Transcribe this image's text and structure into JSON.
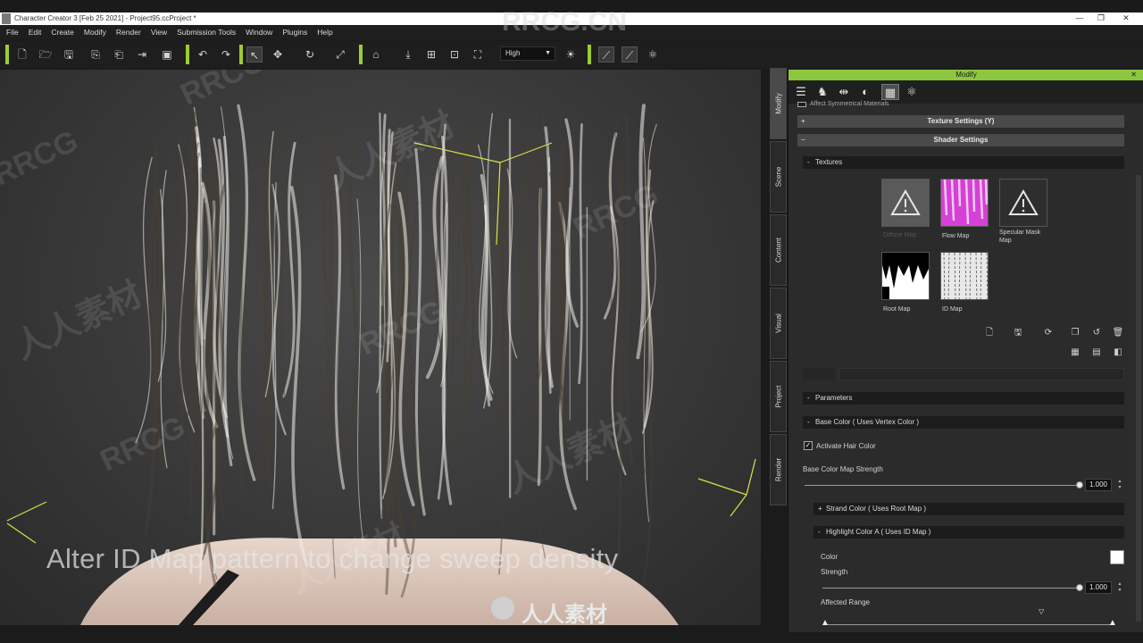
{
  "window": {
    "title": "Character Creator 3 [Feb 25 2021] - Project95.ccProject *",
    "min": "—",
    "max": "❐",
    "close": "✕"
  },
  "menu": [
    "File",
    "Edit",
    "Create",
    "Modify",
    "Render",
    "View",
    "Submission Tools",
    "Window",
    "Plugins",
    "Help"
  ],
  "toolbar": {
    "quality": "High"
  },
  "viewport": {
    "subtitle": "Alter ID Map pattern to change sweep density"
  },
  "watermarks": {
    "top": "RRCG.CN",
    "brand": "RRCG",
    "cn": "人人素材"
  },
  "side_tabs": [
    "Modify",
    "Scene",
    "Content",
    "Visual",
    "Project",
    "Render"
  ],
  "panel": {
    "title": "Modify",
    "affect_symmetrical": "Affect Symmetrical Materials",
    "texture_settings": "Texture Settings  (Y)",
    "shader_settings": "Shader Settings",
    "textures_header": "Textures",
    "textures": [
      {
        "label": "Diffuse Map"
      },
      {
        "label": "Flow Map"
      },
      {
        "label": "Specular Mask Map"
      },
      {
        "label": "Root Map"
      },
      {
        "label": "ID Map"
      }
    ],
    "parameters_header": "Parameters",
    "base_color_header": "Base Color ( Uses Vertex Color )",
    "activate_hair_color": "Activate Hair Color",
    "base_color_map_strength_label": "Base Color Map Strength",
    "base_color_map_strength_value": "1.000",
    "base_color_map_strength_fraction": 1.0,
    "strand_color_header": "Strand Color ( Uses Root Map )",
    "highlight_header": "Highlight Color A ( Uses ID Map )",
    "color_label": "Color",
    "highlight_color": "#ffffff",
    "strength_label": "Strength",
    "strength_value": "1.000",
    "strength_fraction": 1.0,
    "affected_range_label": "Affected Range"
  },
  "colors": {
    "accent": "#8dc63f",
    "flow_map": "#d640d6"
  },
  "footer_logo": "人人素材"
}
